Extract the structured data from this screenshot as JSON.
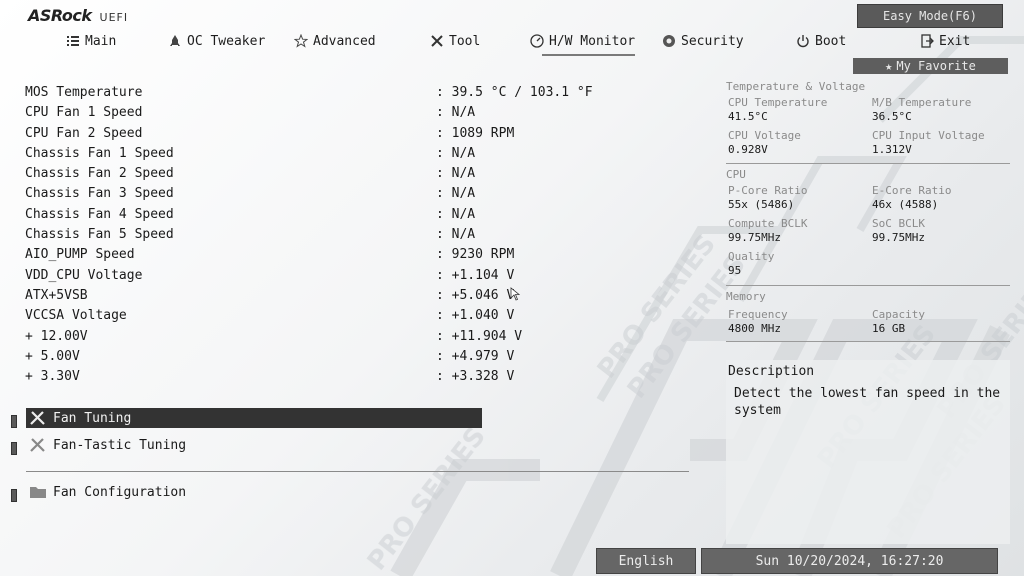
{
  "header": {
    "brand": "ASRock",
    "brand_sub": "UEFI",
    "easy_mode_label": "Easy Mode(F6)",
    "favorite_label": "My Favorite"
  },
  "nav": {
    "items": [
      {
        "label": "Main",
        "icon": "list-icon"
      },
      {
        "label": "OC Tweaker",
        "icon": "rocket-icon"
      },
      {
        "label": "Advanced",
        "icon": "star-icon"
      },
      {
        "label": "Tool",
        "icon": "tools-icon"
      },
      {
        "label": "H/W Monitor",
        "icon": "gauge-icon",
        "active": true
      },
      {
        "label": "Security",
        "icon": "shield-icon"
      },
      {
        "label": "Boot",
        "icon": "power-icon"
      },
      {
        "label": "Exit",
        "icon": "exit-icon"
      }
    ]
  },
  "readings": [
    {
      "label": "MOS Temperature",
      "value": ": 39.5 °C / 103.1 °F"
    },
    {
      "label": "CPU Fan 1 Speed",
      "value": ": N/A"
    },
    {
      "label": "CPU Fan 2 Speed",
      "value": ": 1089 RPM"
    },
    {
      "label": "Chassis Fan 1 Speed",
      "value": ": N/A"
    },
    {
      "label": "Chassis Fan 2 Speed",
      "value": ": N/A"
    },
    {
      "label": "Chassis Fan 3 Speed",
      "value": ": N/A"
    },
    {
      "label": "Chassis Fan 4 Speed",
      "value": ": N/A"
    },
    {
      "label": "Chassis Fan 5 Speed",
      "value": ": N/A"
    },
    {
      "label": "AIO_PUMP Speed",
      "value": ": 9230 RPM"
    },
    {
      "label": "VDD_CPU Voltage",
      "value": ": +1.104 V"
    },
    {
      "label": "ATX+5VSB",
      "value": ": +5.046 V"
    },
    {
      "label": "VCCSA Voltage",
      "value": ": +1.040 V"
    },
    {
      "label": "+ 12.00V",
      "value": ": +11.904 V"
    },
    {
      "label": "+ 5.00V",
      "value": ": +4.979 V"
    },
    {
      "label": "+ 3.30V",
      "value": ": +3.328 V"
    }
  ],
  "menu": {
    "fan_tuning": "Fan Tuning",
    "fan_tastic": "Fan-Tastic Tuning",
    "fan_config": "Fan Configuration"
  },
  "panel": {
    "tv_heading": "Temperature & Voltage",
    "cpu_temp_label": "CPU Temperature",
    "cpu_temp_value": "41.5°C",
    "mb_temp_label": "M/B Temperature",
    "mb_temp_value": "36.5°C",
    "cpu_volt_label": "CPU Voltage",
    "cpu_volt_value": "0.928V",
    "cpu_in_volt_label": "CPU Input Voltage",
    "cpu_in_volt_value": "1.312V",
    "cpu_heading": "CPU",
    "pcore_label": "P-Core Ratio",
    "pcore_value": "55x (5486)",
    "ecore_label": "E-Core Ratio",
    "ecore_value": "46x (4588)",
    "compute_label": "Compute BCLK",
    "compute_value": "99.75MHz",
    "soc_label": "SoC BCLK",
    "soc_value": "99.75MHz",
    "quality_label": "Quality",
    "quality_value": "95",
    "mem_heading": "Memory",
    "freq_label": "Frequency",
    "freq_value": "4800 MHz",
    "cap_label": "Capacity",
    "cap_value": "16 GB"
  },
  "description": {
    "title": "Description",
    "text": "Detect the lowest fan speed in the system"
  },
  "footer": {
    "language": "English",
    "datetime": "Sun 10/20/2024, 16:27:20"
  },
  "watermark": "PRO SERIES"
}
